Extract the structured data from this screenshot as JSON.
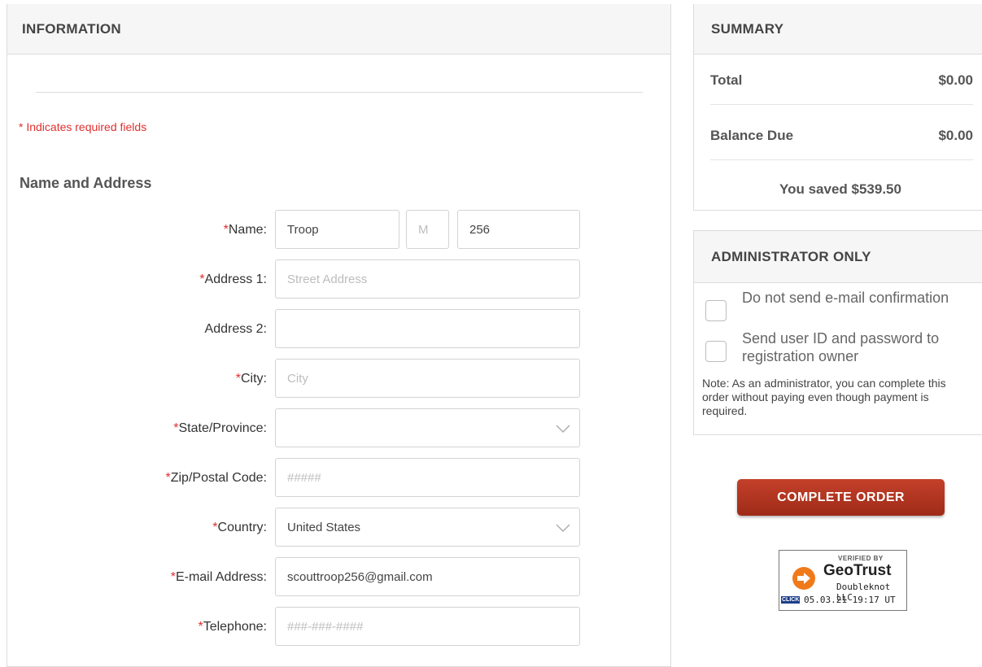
{
  "information": {
    "header": "INFORMATION",
    "required_note": "* Indicates required fields",
    "section_title": "Name and Address",
    "fields": {
      "name": {
        "label": "Name:",
        "first": "Troop",
        "middle_placeholder": "M",
        "last": "256"
      },
      "address1": {
        "label": "Address 1:",
        "placeholder": "Street Address"
      },
      "address2": {
        "label": "Address 2:",
        "value": ""
      },
      "city": {
        "label": "City:",
        "placeholder": "City"
      },
      "state": {
        "label": "State/Province:",
        "value": ""
      },
      "zip": {
        "label": "Zip/Postal Code:",
        "placeholder": "#####"
      },
      "country": {
        "label": "Country:",
        "value": "United States"
      },
      "email": {
        "label": "E-mail Address:",
        "value": "scouttroop256@gmail.com"
      },
      "telephone": {
        "label": "Telephone:",
        "placeholder": "###-###-####"
      }
    },
    "required_marker": "*"
  },
  "summary": {
    "header": "SUMMARY",
    "total_label": "Total",
    "total_value": "$0.00",
    "balance_label": "Balance Due",
    "balance_value": "$0.00",
    "saved_text": "You saved $539.50"
  },
  "admin": {
    "header": "ADMINISTRATOR ONLY",
    "options": [
      {
        "label": "Do not send e-mail confirmation",
        "checked": false
      },
      {
        "label": "Send user ID and password to registration owner",
        "checked": false
      }
    ],
    "note": "Note: As an administrator, you can complete this order without paying even though payment is required."
  },
  "actions": {
    "complete_label": "COMPLETE ORDER"
  },
  "seal": {
    "verified": "VERIFIED BY",
    "brand": "GeoTrust",
    "company": "Doubleknot LLC",
    "click": "CLICK",
    "date": "05.03.21 19:17 UT"
  },
  "colors": {
    "required": "#e03030",
    "button": "#b23622"
  }
}
